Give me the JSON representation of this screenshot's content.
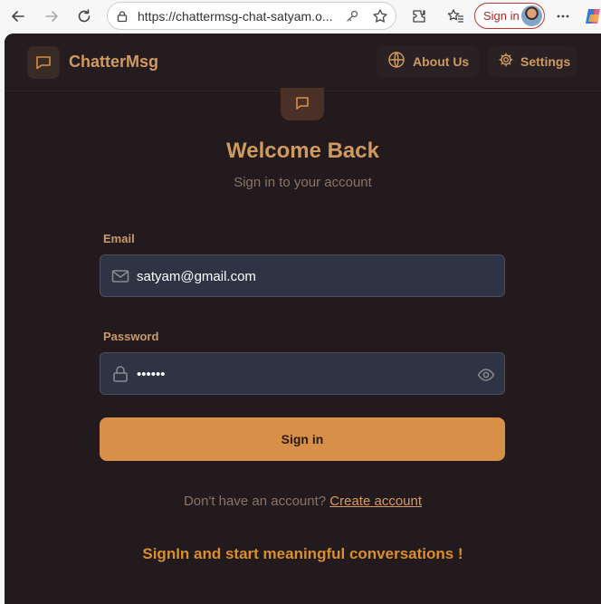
{
  "browser": {
    "url": "https://chattermsg-chat-satyam.o...",
    "signin_label": "Sign in"
  },
  "header": {
    "brand": "ChatterMsg",
    "about_label": "About Us",
    "settings_label": "Settings"
  },
  "main": {
    "title": "Welcome Back",
    "subtitle": "Sign in to your account",
    "email_label": "Email",
    "email_value": "satyam@gmail.com",
    "password_label": "Password",
    "password_value": "••••••",
    "signin_button": "Sign in",
    "no_account_text": "Don't have an account?",
    "create_account_link": "Create account",
    "tagline": "SignIn and start meaningful conversations !"
  },
  "colors": {
    "accent": "#d88f48",
    "background": "#221a1d",
    "input_bg": "#2f3444",
    "brand_text": "#d09a5e"
  },
  "icons": [
    "back-icon",
    "forward-icon",
    "reload-icon",
    "lock-icon",
    "key-icon",
    "star-icon",
    "extensions-icon",
    "favorites-icon",
    "more-icon",
    "copilot-icon",
    "chat-bubble-icon",
    "globe-icon",
    "gear-icon",
    "mail-icon",
    "password-lock-icon",
    "eye-icon"
  ]
}
